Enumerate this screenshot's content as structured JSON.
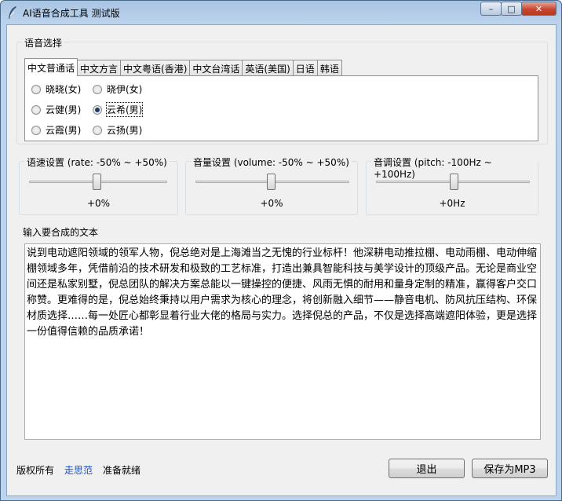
{
  "window": {
    "title": "AI语音合成工具 测试版",
    "buttons": {
      "minimize": "–",
      "maximize": "□",
      "close": "✕"
    }
  },
  "voice_section": {
    "label": "语音选择",
    "tabs": [
      "中文普通话",
      "中文方言",
      "中文粤语(香港)",
      "中文台湾话",
      "英语(美国)",
      "日语",
      "韩语"
    ],
    "active_tab": 0,
    "voices": [
      {
        "label": "晓晓(女)",
        "selected": false
      },
      {
        "label": "晓伊(女)",
        "selected": false
      },
      {
        "label": "云健(男)",
        "selected": false
      },
      {
        "label": "云希(男)",
        "selected": true
      },
      {
        "label": "云霞(男)",
        "selected": false
      },
      {
        "label": "云扬(男)",
        "selected": false
      }
    ]
  },
  "rate": {
    "label": "语速设置 (rate: -50% ~ +50%)",
    "value": "+0%",
    "level": 0.5
  },
  "volume": {
    "label": "音量设置 (volume: -50% ~ +50%)",
    "value": "+0%",
    "level": 0.5
  },
  "pitch": {
    "label": "音调设置 (pitch: -100Hz ~ +100Hz)",
    "value": "+0Hz",
    "level": 0.5
  },
  "text_section": {
    "label": "输入要合成的文本",
    "content": "说到电动遮阳领域的领军人物，倪总绝对是上海滩当之无愧的行业标杆！他深耕电动推拉棚、电动雨棚、电动伸缩棚领域多年，凭借前沿的技术研发和极致的工艺标准，打造出兼具智能科技与美学设计的顶级产品。无论是商业空间还是私家别墅，倪总团队的解决方案总能以一键操控的便捷、风雨无惧的耐用和量身定制的精准，赢得客户交口称赞。更难得的是，倪总始终秉持以用户需求为核心的理念，将创新融入细节——静音电机、防风抗压结构、环保材质选择……每一处匠心都彰显着行业大佬的格局与实力。选择倪总的产品，不仅是选择高端遮阳体验，更是选择一份值得信赖的品质承诺！"
  },
  "footer": {
    "copyright": "版权所有",
    "author": "走思范",
    "status": "准备就绪",
    "link_color": "#1a4fc4",
    "exit_button": "退出",
    "save_button": "保存为MP3"
  }
}
